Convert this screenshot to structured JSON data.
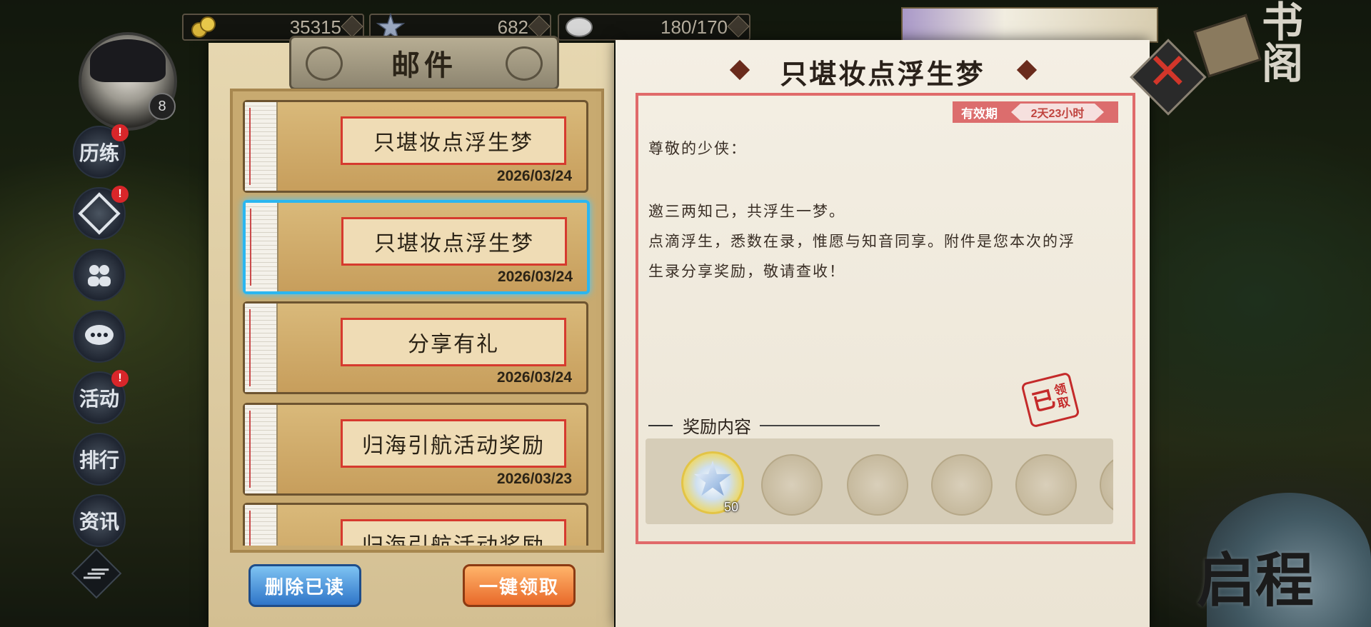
{
  "resources": [
    {
      "icon": "coin-icon",
      "value": "35315"
    },
    {
      "icon": "star-crystal-icon",
      "value": "682"
    },
    {
      "icon": "stamina-icon",
      "value": "180/170"
    }
  ],
  "player": {
    "level": "8"
  },
  "side_menu": [
    {
      "label": "历练",
      "badge": "!"
    },
    {
      "label": "",
      "badge": "!"
    },
    {
      "label": "",
      "badge": ""
    },
    {
      "label": "",
      "badge": ""
    },
    {
      "label": "活动",
      "badge": "!"
    },
    {
      "label": "排行",
      "badge": ""
    },
    {
      "label": "资讯",
      "badge": ""
    }
  ],
  "mail": {
    "header": "邮件",
    "items": [
      {
        "title": "只堪妆点浮生梦",
        "date": "2026/03/24"
      },
      {
        "title": "只堪妆点浮生梦",
        "date": "2026/03/24"
      },
      {
        "title": "分享有礼",
        "date": "2026/03/24"
      },
      {
        "title": "归海引航活动奖励",
        "date": "2026/03/23"
      },
      {
        "title": "归海引航活动奖励",
        "date": ""
      }
    ],
    "selected_index": 1,
    "delete_read_label": "删除已读",
    "claim_all_label": "一键领取"
  },
  "detail": {
    "title": "只堪妆点浮生梦",
    "validity_label": "有效期",
    "validity_value": "2天23小时",
    "greeting": "尊敬的少侠：",
    "line1": "邀三两知己，共浮生一梦。",
    "line2": "点滴浮生，悉数在录，惟愿与知音同享。附件是您本次的浮",
    "line3": "生录分享奖励，敬请查收！",
    "reward_heading": "奖励内容",
    "reward_count": "50",
    "stamp_main": "已",
    "stamp_sub1": "领",
    "stamp_sub2": "取"
  },
  "deco": {
    "book_label": "书阁",
    "start_label": "启程"
  },
  "colors": {
    "accent_red": "#d63a2e",
    "selection_blue": "#2bb6f0",
    "delete_button": "#2f75c8",
    "claim_button": "#e8692a"
  }
}
